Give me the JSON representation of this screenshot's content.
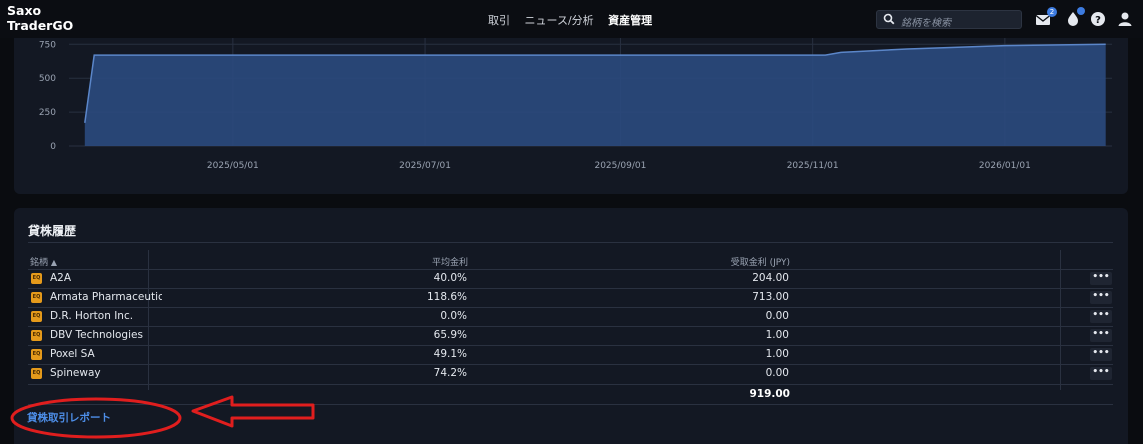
{
  "app": {
    "logo_line1": "Saxo",
    "logo_line2": "TraderGO"
  },
  "nav": {
    "trade": "取引",
    "news": "ニュース/分析",
    "assets": "資産管理"
  },
  "search": {
    "placeholder": "銘柄を検索"
  },
  "header_icons": {
    "mail": "mail-icon",
    "mail_badge": "2",
    "notifications": "notification-icon",
    "help": "help-icon",
    "user": "user-icon"
  },
  "colors": {
    "accent": "#3d7be0",
    "area_fill": "#2b4a7e",
    "highlight_red": "#e01e1e",
    "equity_badge": "#e59a1b"
  },
  "chart_data": {
    "type": "area",
    "y_ticks": [
      "750",
      "500",
      "250",
      "0"
    ],
    "x_ticks": [
      "2025/05/01",
      "2025/07/01",
      "2025/09/01",
      "2025/11/01",
      "2026/01/01"
    ],
    "ylim": [
      0,
      800
    ],
    "grid": true,
    "series": [
      {
        "x": [
          "2025-03-15",
          "2025-03-18",
          "2025-11-05",
          "2025-11-10",
          "2025-12-01",
          "2026-01-01",
          "2026-02-02"
        ],
        "y": [
          170,
          670,
          670,
          690,
          715,
          740,
          750
        ]
      }
    ]
  },
  "lending": {
    "title": "貸株履歴",
    "columns": {
      "symbol": "銘柄",
      "sort_indicator": "▲",
      "avg_rate": "平均金利",
      "received": "受取金利 (JPY)"
    },
    "rows": [
      {
        "badge": "EQ",
        "name": "A2A",
        "rate": "40.0%",
        "received": "204.00",
        "more": "•••"
      },
      {
        "badge": "EQ",
        "name": "Armata Pharmaceuticals",
        "rate": "118.6%",
        "received": "713.00",
        "more": "•••"
      },
      {
        "badge": "EQ",
        "name": "D.R. Horton Inc.",
        "rate": "0.0%",
        "received": "0.00",
        "more": "•••"
      },
      {
        "badge": "EQ",
        "name": "DBV Technologies",
        "rate": "65.9%",
        "received": "1.00",
        "more": "•••"
      },
      {
        "badge": "EQ",
        "name": "Poxel SA",
        "rate": "49.1%",
        "received": "1.00",
        "more": "•••"
      },
      {
        "badge": "EQ",
        "name": "Spineway",
        "rate": "74.2%",
        "received": "0.00",
        "more": "•••"
      }
    ],
    "total": "919.00",
    "report_link": "貸株取引レポート"
  }
}
